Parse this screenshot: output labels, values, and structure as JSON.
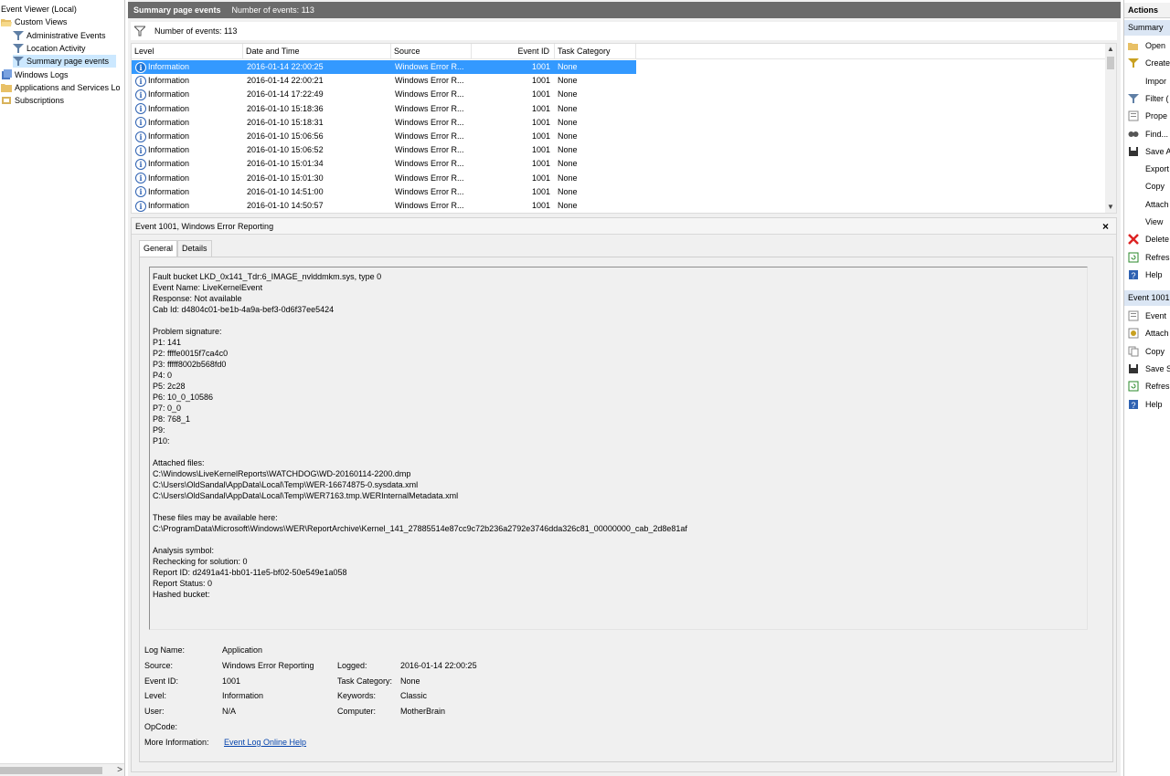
{
  "tree": {
    "root": "Event Viewer (Local)",
    "custom_views": "Custom Views",
    "admin_events": "Administrative Events",
    "location_activity": "Location Activity",
    "summary_page_events": "Summary page events",
    "windows_logs": "Windows Logs",
    "apps_services": "Applications and Services Lo",
    "subscriptions": "Subscriptions"
  },
  "center": {
    "title": "Summary page events",
    "count_label": "Number of events: 113",
    "filter_text": "Number of events: 113"
  },
  "grid": {
    "columns": [
      "Level",
      "Date and Time",
      "Source",
      "Event ID",
      "Task Category"
    ],
    "rows": [
      {
        "level": "Information",
        "date": "2016-01-14 22:00:25",
        "source": "Windows Error R...",
        "id": "1001",
        "category": "None"
      },
      {
        "level": "Information",
        "date": "2016-01-14 22:00:21",
        "source": "Windows Error R...",
        "id": "1001",
        "category": "None"
      },
      {
        "level": "Information",
        "date": "2016-01-14 17:22:49",
        "source": "Windows Error R...",
        "id": "1001",
        "category": "None"
      },
      {
        "level": "Information",
        "date": "2016-01-10 15:18:36",
        "source": "Windows Error R...",
        "id": "1001",
        "category": "None"
      },
      {
        "level": "Information",
        "date": "2016-01-10 15:18:31",
        "source": "Windows Error R...",
        "id": "1001",
        "category": "None"
      },
      {
        "level": "Information",
        "date": "2016-01-10 15:06:56",
        "source": "Windows Error R...",
        "id": "1001",
        "category": "None"
      },
      {
        "level": "Information",
        "date": "2016-01-10 15:06:52",
        "source": "Windows Error R...",
        "id": "1001",
        "category": "None"
      },
      {
        "level": "Information",
        "date": "2016-01-10 15:01:34",
        "source": "Windows Error R...",
        "id": "1001",
        "category": "None"
      },
      {
        "level": "Information",
        "date": "2016-01-10 15:01:30",
        "source": "Windows Error R...",
        "id": "1001",
        "category": "None"
      },
      {
        "level": "Information",
        "date": "2016-01-10 14:51:00",
        "source": "Windows Error R...",
        "id": "1001",
        "category": "None"
      },
      {
        "level": "Information",
        "date": "2016-01-10 14:50:57",
        "source": "Windows Error R...",
        "id": "1001",
        "category": "None"
      }
    ]
  },
  "detail": {
    "title": "Event 1001, Windows Error Reporting",
    "close": "×",
    "tabs": [
      "General",
      "Details"
    ],
    "description": "Fault bucket LKD_0x141_Tdr:6_IMAGE_nvlddmkm.sys, type 0\nEvent Name: LiveKernelEvent\nResponse: Not available\nCab Id: d4804c01-be1b-4a9a-bef3-0d6f37ee5424\n\nProblem signature:\nP1: 141\nP2: ffffe0015f7ca4c0\nP3: fffff8002b568fd0\nP4: 0\nP5: 2c28\nP6: 10_0_10586\nP7: 0_0\nP8: 768_1\nP9: \nP10: \n\nAttached files:\nC:\\Windows\\LiveKernelReports\\WATCHDOG\\WD-20160114-2200.dmp\nC:\\Users\\OldSandal\\AppData\\Local\\Temp\\WER-16674875-0.sysdata.xml\nC:\\Users\\OldSandal\\AppData\\Local\\Temp\\WER7163.tmp.WERInternalMetadata.xml\n\nThese files may be available here:\nC:\\ProgramData\\Microsoft\\Windows\\WER\\ReportArchive\\Kernel_141_27885514e87cc9c72b236a2792e3746dda326c81_00000000_cab_2d8e81af\n\nAnalysis symbol: \nRechecking for solution: 0\nReport ID: d2491a41-bb01-11e5-bf02-50e549e1a058\nReport Status: 0\nHashed bucket: ",
    "props": {
      "log_name_label": "Log Name:",
      "log_name": "Application",
      "source_label": "Source:",
      "source": "Windows Error Reporting",
      "logged_label": "Logged:",
      "logged": "2016-01-14 22:00:25",
      "event_id_label": "Event ID:",
      "event_id": "1001",
      "task_cat_label": "Task Category:",
      "task_cat": "None",
      "level_label": "Level:",
      "level": "Information",
      "keywords_label": "Keywords:",
      "keywords": "Classic",
      "user_label": "User:",
      "user": "N/A",
      "computer_label": "Computer:",
      "computer": "MotherBrain",
      "opcode_label": "OpCode:",
      "more_info_label": "More Information:",
      "more_info_link": "Event Log Online Help"
    }
  },
  "actions": {
    "header": "Actions",
    "section1": "Summary",
    "items1": [
      "Open",
      "Create",
      "Impor",
      "Filter (",
      "Prope",
      "Find...",
      "Save A",
      "Export",
      "Copy",
      "Attach",
      "View",
      "Delete",
      "Refres",
      "Help"
    ],
    "section2": "Event 1001",
    "items2": [
      "Event",
      "Attach",
      "Copy",
      "Save S",
      "Refres",
      "Help"
    ]
  }
}
